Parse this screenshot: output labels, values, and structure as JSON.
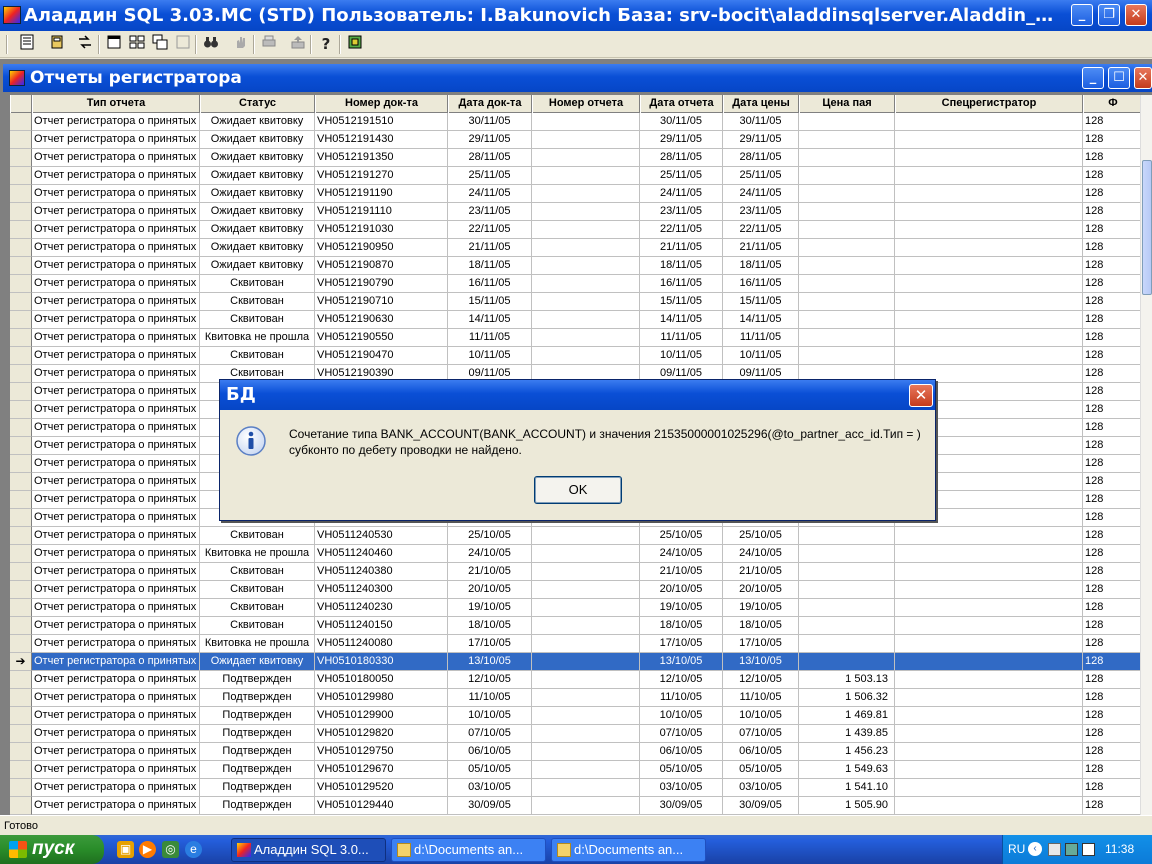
{
  "window": {
    "title": "Аладдин SQL 3.03.MC (STD)  Пользователь: I.Bakunovich База: srv-bocit\\aladdinsqlserver.Aladdin_KIT Опердень...",
    "minimize_glyph": "_",
    "maximize_glyph": "❐",
    "close_glyph": "✕"
  },
  "toolbar": {
    "icons": [
      "report-icon",
      "database-icon",
      "transfer-icon",
      "window-icon",
      "tile-icon",
      "cascade-icon",
      "disabled-window-icon",
      "binoculars-icon",
      "hand-icon",
      "print-icon",
      "export-icon",
      "help-icon",
      "chip-icon"
    ]
  },
  "child_window": {
    "title": "Отчеты регистратора",
    "minimize_glyph": "_",
    "maximize_glyph": "☐",
    "close_glyph": "✕"
  },
  "grid": {
    "columns": [
      "Тип отчета",
      "Статус",
      "Номер док-та",
      "Дата док-та",
      "Номер отчета",
      "Дата отчета",
      "Дата цены",
      "Цена пая",
      "Спецрегистратор",
      "Ф"
    ],
    "selected_indicator": "➔",
    "rows": [
      [
        "Отчет регистратора о принятых :",
        "Ожидает квитовку",
        "VH0512191510",
        "30/11/05",
        "",
        "30/11/05",
        "30/11/05",
        "",
        "",
        "128"
      ],
      [
        "Отчет регистратора о принятых :",
        "Ожидает квитовку",
        "VH0512191430",
        "29/11/05",
        "",
        "29/11/05",
        "29/11/05",
        "",
        "",
        "128"
      ],
      [
        "Отчет регистратора о принятых :",
        "Ожидает квитовку",
        "VH0512191350",
        "28/11/05",
        "",
        "28/11/05",
        "28/11/05",
        "",
        "",
        "128"
      ],
      [
        "Отчет регистратора о принятых :",
        "Ожидает квитовку",
        "VH0512191270",
        "25/11/05",
        "",
        "25/11/05",
        "25/11/05",
        "",
        "",
        "128"
      ],
      [
        "Отчет регистратора о принятых :",
        "Ожидает квитовку",
        "VH0512191190",
        "24/11/05",
        "",
        "24/11/05",
        "24/11/05",
        "",
        "",
        "128"
      ],
      [
        "Отчет регистратора о принятых :",
        "Ожидает квитовку",
        "VH0512191110",
        "23/11/05",
        "",
        "23/11/05",
        "23/11/05",
        "",
        "",
        "128"
      ],
      [
        "Отчет регистратора о принятых :",
        "Ожидает квитовку",
        "VH0512191030",
        "22/11/05",
        "",
        "22/11/05",
        "22/11/05",
        "",
        "",
        "128"
      ],
      [
        "Отчет регистратора о принятых :",
        "Ожидает квитовку",
        "VH0512190950",
        "21/11/05",
        "",
        "21/11/05",
        "21/11/05",
        "",
        "",
        "128"
      ],
      [
        "Отчет регистратора о принятых :",
        "Ожидает квитовку",
        "VH0512190870",
        "18/11/05",
        "",
        "18/11/05",
        "18/11/05",
        "",
        "",
        "128"
      ],
      [
        "Отчет регистратора о принятых :",
        "Сквитован",
        "VH0512190790",
        "16/11/05",
        "",
        "16/11/05",
        "16/11/05",
        "",
        "",
        "128"
      ],
      [
        "Отчет регистратора о принятых :",
        "Сквитован",
        "VH0512190710",
        "15/11/05",
        "",
        "15/11/05",
        "15/11/05",
        "",
        "",
        "128"
      ],
      [
        "Отчет регистратора о принятых :",
        "Сквитован",
        "VH0512190630",
        "14/11/05",
        "",
        "14/11/05",
        "14/11/05",
        "",
        "",
        "128"
      ],
      [
        "Отчет регистратора о принятых :",
        "Квитовка не прошла",
        "VH0512190550",
        "11/11/05",
        "",
        "11/11/05",
        "11/11/05",
        "",
        "",
        "128"
      ],
      [
        "Отчет регистратора о принятых :",
        "Сквитован",
        "VH0512190470",
        "10/11/05",
        "",
        "10/11/05",
        "10/11/05",
        "",
        "",
        "128"
      ],
      [
        "Отчет регистратора о принятых :",
        "Сквитован",
        "VH0512190390",
        "09/11/05",
        "",
        "09/11/05",
        "09/11/05",
        "",
        "",
        "128"
      ],
      [
        "Отчет регистратора о принятых :",
        "",
        "",
        "",
        "",
        "",
        "",
        "",
        "",
        "128"
      ],
      [
        "Отчет регистратора о принятых :",
        "",
        "",
        "",
        "",
        "",
        "",
        "",
        "",
        "128"
      ],
      [
        "Отчет регистратора о принятых :",
        "Кви",
        "",
        "",
        "",
        "",
        "",
        "",
        "",
        "128"
      ],
      [
        "Отчет регистратора о принятых :",
        "",
        "",
        "",
        "",
        "",
        "",
        "",
        "",
        "128"
      ],
      [
        "Отчет регистратора о принятых :",
        "Кви",
        "",
        "",
        "",
        "",
        "",
        "",
        "",
        "128"
      ],
      [
        "Отчет регистратора о принятых :",
        "Кви",
        "",
        "",
        "",
        "",
        "",
        "",
        "",
        "128"
      ],
      [
        "Отчет регистратора о принятых :",
        "Кви",
        "",
        "",
        "",
        "",
        "",
        "",
        "",
        "128"
      ],
      [
        "Отчет регистратора о принятых :",
        "",
        "",
        "",
        "",
        "",
        "",
        "",
        "",
        "128"
      ],
      [
        "Отчет регистратора о принятых :",
        "Сквитован",
        "VH0511240530",
        "25/10/05",
        "",
        "25/10/05",
        "25/10/05",
        "",
        "",
        "128"
      ],
      [
        "Отчет регистратора о принятых :",
        "Квитовка не прошла",
        "VH0511240460",
        "24/10/05",
        "",
        "24/10/05",
        "24/10/05",
        "",
        "",
        "128"
      ],
      [
        "Отчет регистратора о принятых :",
        "Сквитован",
        "VH0511240380",
        "21/10/05",
        "",
        "21/10/05",
        "21/10/05",
        "",
        "",
        "128"
      ],
      [
        "Отчет регистратора о принятых :",
        "Сквитован",
        "VH0511240300",
        "20/10/05",
        "",
        "20/10/05",
        "20/10/05",
        "",
        "",
        "128"
      ],
      [
        "Отчет регистратора о принятых :",
        "Сквитован",
        "VH0511240230",
        "19/10/05",
        "",
        "19/10/05",
        "19/10/05",
        "",
        "",
        "128"
      ],
      [
        "Отчет регистратора о принятых :",
        "Сквитован",
        "VH0511240150",
        "18/10/05",
        "",
        "18/10/05",
        "18/10/05",
        "",
        "",
        "128"
      ],
      [
        "Отчет регистратора о принятых :",
        "Квитовка не прошла",
        "VH0511240080",
        "17/10/05",
        "",
        "17/10/05",
        "17/10/05",
        "",
        "",
        "128"
      ],
      [
        "Отчет регистратора о принятых :",
        "Ожидает квитовку",
        "VH0510180330",
        "13/10/05",
        "",
        "13/10/05",
        "13/10/05",
        "",
        "",
        "128"
      ],
      [
        "Отчет регистратора о принятых :",
        "Подтвержден",
        "VH0510180050",
        "12/10/05",
        "",
        "12/10/05",
        "12/10/05",
        "1 503.13",
        "",
        "128"
      ],
      [
        "Отчет регистратора о принятых :",
        "Подтвержден",
        "VH0510129980",
        "11/10/05",
        "",
        "11/10/05",
        "11/10/05",
        "1 506.32",
        "",
        "128"
      ],
      [
        "Отчет регистратора о принятых :",
        "Подтвержден",
        "VH0510129900",
        "10/10/05",
        "",
        "10/10/05",
        "10/10/05",
        "1 469.81",
        "",
        "128"
      ],
      [
        "Отчет регистратора о принятых :",
        "Подтвержден",
        "VH0510129820",
        "07/10/05",
        "",
        "07/10/05",
        "07/10/05",
        "1 439.85",
        "",
        "128"
      ],
      [
        "Отчет регистратора о принятых :",
        "Подтвержден",
        "VH0510129750",
        "06/10/05",
        "",
        "06/10/05",
        "06/10/05",
        "1 456.23",
        "",
        "128"
      ],
      [
        "Отчет регистратора о принятых :",
        "Подтвержден",
        "VH0510129670",
        "05/10/05",
        "",
        "05/10/05",
        "05/10/05",
        "1 549.63",
        "",
        "128"
      ],
      [
        "Отчет регистратора о принятых :",
        "Подтвержден",
        "VH0510129520",
        "03/10/05",
        "",
        "03/10/05",
        "03/10/05",
        "1 541.10",
        "",
        "128"
      ],
      [
        "Отчет регистратора о принятых :",
        "Подтвержден",
        "VH0510129440",
        "30/09/05",
        "",
        "30/09/05",
        "30/09/05",
        "1 505.90",
        "",
        "128"
      ]
    ]
  },
  "dialog": {
    "title": "БД",
    "message": "Сочетание типа BANK_ACCOUNT(BANK_ACCOUNT) и значения 21535000001025296(@to_partner_acc_id.Тип = ) субконто по дебету проводки не найдено.",
    "ok_label": "OK",
    "close_glyph": "✕",
    "icon": "info-icon"
  },
  "status": {
    "text": "Готово"
  },
  "taskbar": {
    "start_label": "пуск",
    "tasks": [
      "Аладдин SQL 3.0...",
      "d:\\Documents an...",
      "d:\\Documents an..."
    ],
    "language": "RU",
    "clock": "11:38"
  },
  "colors": {
    "selection": "#316ac5",
    "titlebar": "#0a4fd6",
    "face": "#ece9d8"
  }
}
